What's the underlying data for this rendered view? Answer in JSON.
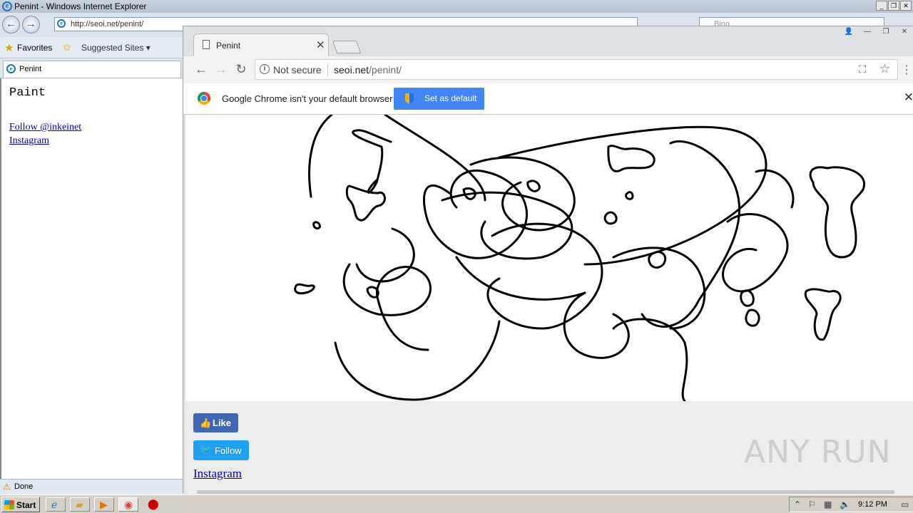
{
  "ie": {
    "title": "Penint - Windows Internet Explorer",
    "address": "http://seoi.net/penint/",
    "search_placeholder": "Bing",
    "favorites_label": "Favorites",
    "suggested_sites_label": "Suggested Sites ▾",
    "tab_label": "Penint",
    "page": {
      "heading": "Paint",
      "follow_link": "Follow @inkeinet",
      "instagram_link": "Instagram"
    },
    "status_text": "Done"
  },
  "chrome": {
    "tab_title": "Penint",
    "security_label": "Not secure",
    "url_host": "seoi.net",
    "url_path": "/penint/",
    "infobar_message": "Google Chrome isn't your default browser",
    "set_default_label": "Set as default",
    "page": {
      "like_label": "Like",
      "follow_label": "Follow",
      "instagram_link": "Instagram"
    }
  },
  "watermark": "ANY RUN",
  "taskbar": {
    "start_label": "Start",
    "clock": "9:12 PM"
  },
  "colors": {
    "facebook_blue": "#4267b2",
    "twitter_blue": "#1da1f2",
    "chrome_button_blue": "#4285f4",
    "link_blue": "#0000cc"
  }
}
